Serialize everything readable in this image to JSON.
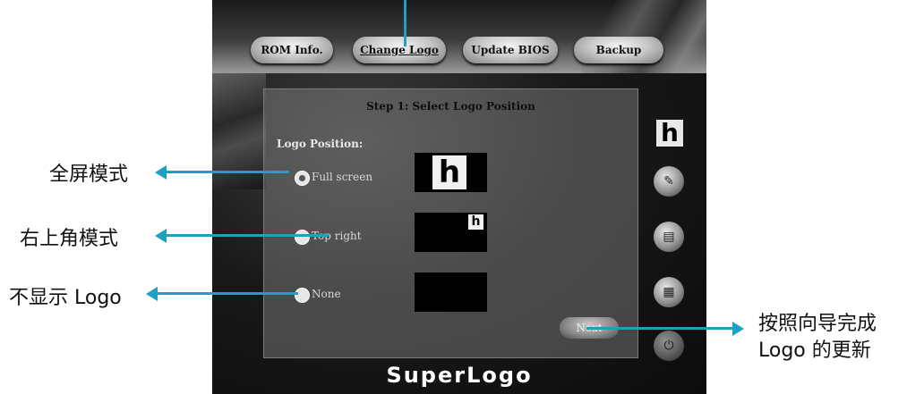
{
  "tabs": [
    "ROM Info.",
    "Change Logo",
    "Update BIOS",
    "Backup"
  ],
  "panel": {
    "title": "Step 1: Select Logo Position",
    "position_label": "Logo Position:",
    "options": [
      "Full screen",
      "Top right",
      "None"
    ],
    "selected": "Full screen",
    "next_label": "Next"
  },
  "brand": "SuperLogo",
  "callouts": {
    "fullscreen": "全屏模式",
    "topright": "右上角模式",
    "none": "不显示 Logo",
    "wizard_line1": "按照向导完成",
    "wizard_line2": "Logo 的更新"
  },
  "logo_glyph": "h",
  "side_icons": [
    "logo-icon",
    "edit-icon",
    "file-icon",
    "chip-icon",
    "power-icon"
  ],
  "colors": {
    "callout_arrow": "#1f9fc1"
  }
}
